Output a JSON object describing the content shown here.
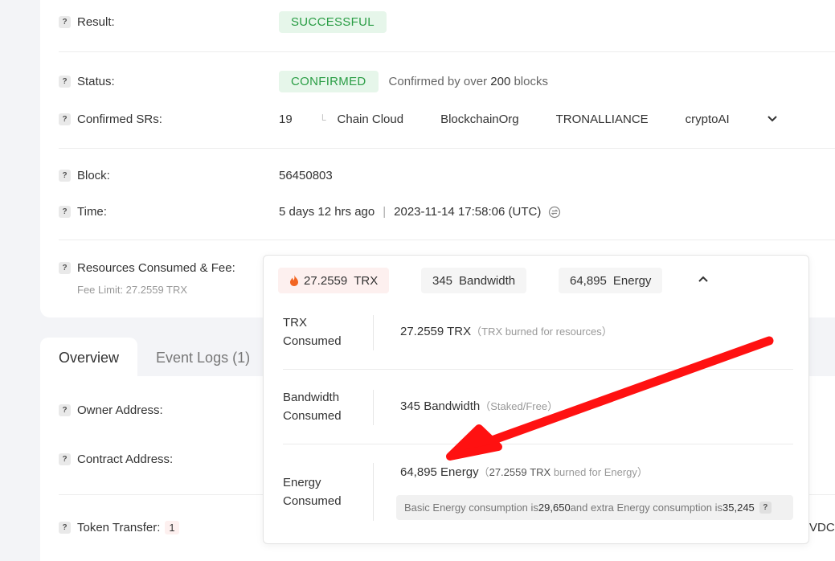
{
  "fields": {
    "result": {
      "label": "Result:",
      "value": "SUCCESSFUL"
    },
    "status": {
      "label": "Status:",
      "value": "CONFIRMED",
      "note_prefix": "Confirmed by over",
      "note_count": "200",
      "note_suffix": "blocks"
    },
    "confirmed_srs": {
      "label": "Confirmed SRs:",
      "count": "19",
      "items": [
        "Chain Cloud",
        "BlockchainOrg",
        "TRONALLIANCE",
        "cryptoAI"
      ]
    },
    "block": {
      "label": "Block:",
      "value": "56450803"
    },
    "time": {
      "label": "Time:",
      "relative": "5 days 12 hrs ago",
      "separator": "|",
      "absolute": "2023-11-14 17:58:06 (UTC)"
    },
    "resources": {
      "label": "Resources Consumed & Fee:",
      "fee_limit": "Fee Limit: 27.2559 TRX"
    }
  },
  "tabs": [
    {
      "label": "Overview",
      "active": true
    },
    {
      "label": "Event Logs (1)",
      "active": false
    }
  ],
  "lower_fields": {
    "owner": {
      "label": "Owner Address:"
    },
    "contract": {
      "label": "Contract Address:"
    },
    "token_transfer": {
      "label": "Token Transfer:",
      "count": "1",
      "cut_text": "VDC"
    }
  },
  "popup": {
    "chips": {
      "trx": {
        "amount": "27.2559",
        "unit": "TRX"
      },
      "bandwidth": {
        "amount": "345",
        "unit": "Bandwidth"
      },
      "energy": {
        "amount": "64,895",
        "unit": "Energy"
      }
    },
    "rows": {
      "trx": {
        "label_1": "TRX",
        "label_2": "Consumed",
        "value": "27.2559 TRX",
        "note": "（TRX burned for resources）"
      },
      "bandwidth": {
        "label_1": "Bandwidth",
        "label_2": "Consumed",
        "value": "345 Bandwidth",
        "note": "（Staked/Free）"
      },
      "energy": {
        "label_1": "Energy",
        "label_2": "Consumed",
        "value": "64,895 Energy",
        "note_prefix": "（",
        "note_trx": "27.2559 TRX",
        "note_suffix": " burned for Energy）",
        "info": {
          "prefix": "Basic Energy consumption is ",
          "basic": "29,650",
          "middle": " and extra Energy consumption is ",
          "extra": "35,245"
        }
      }
    }
  },
  "colors": {
    "success_green": "#2a9d45",
    "annotation_arrow": "#ff1111"
  }
}
